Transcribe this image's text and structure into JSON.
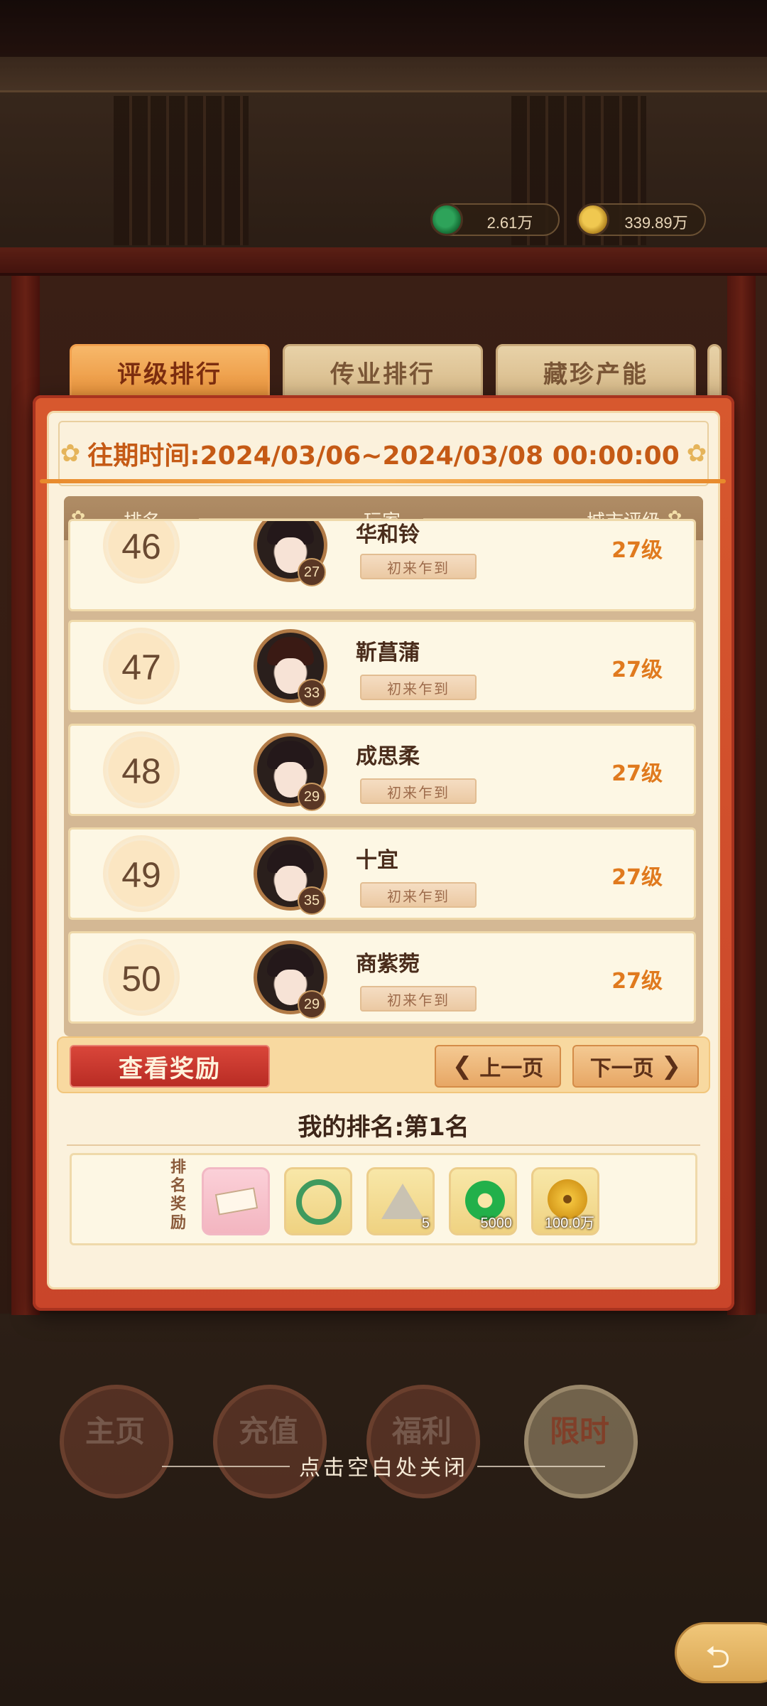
{
  "currencies": [
    {
      "icon": "jade-coin-icon",
      "value": "2.61万"
    },
    {
      "icon": "gold-coin-icon",
      "value": "339.89万"
    }
  ],
  "tabs": [
    {
      "label": "评级排行",
      "active": true
    },
    {
      "label": "传业排行",
      "active": false
    },
    {
      "label": "藏珍产能",
      "active": false
    }
  ],
  "period": "往期时间:2024/03/06~2024/03/08 00:00:00",
  "headers": {
    "rank": "排名",
    "player": "玩家",
    "grade": "城市评级"
  },
  "rows": [
    {
      "rank": "46",
      "name": "华和铃",
      "level": "27",
      "title": "初来乍到",
      "grade": "27级"
    },
    {
      "rank": "47",
      "name": "靳菖蒲",
      "level": "33",
      "title": "初来乍到",
      "grade": "27级"
    },
    {
      "rank": "48",
      "name": "成思柔",
      "level": "29",
      "title": "初来乍到",
      "grade": "27级"
    },
    {
      "rank": "49",
      "name": "十宜",
      "level": "35",
      "title": "初来乍到",
      "grade": "27级"
    },
    {
      "rank": "50",
      "name": "商紫菀",
      "level": "29",
      "title": "初来乍到",
      "grade": "27级"
    }
  ],
  "buttons": {
    "view_reward": "查看奖励",
    "prev_page": "上一页",
    "next_page": "下一页"
  },
  "my_rank": "我的排名:第1名",
  "reward_label": "排名奖励",
  "rewards": [
    {
      "icon": "title-plaque-icon",
      "qty": ""
    },
    {
      "icon": "jade-bracelet-icon",
      "qty": ""
    },
    {
      "icon": "tent-icon",
      "qty": "5"
    },
    {
      "icon": "jade-coin-icon",
      "qty": "5000"
    },
    {
      "icon": "gold-coin-icon",
      "qty": "100.0万"
    }
  ],
  "nav": [
    "主页",
    "充值",
    "福利",
    "限时"
  ],
  "close_hint": "点击空白处关闭"
}
